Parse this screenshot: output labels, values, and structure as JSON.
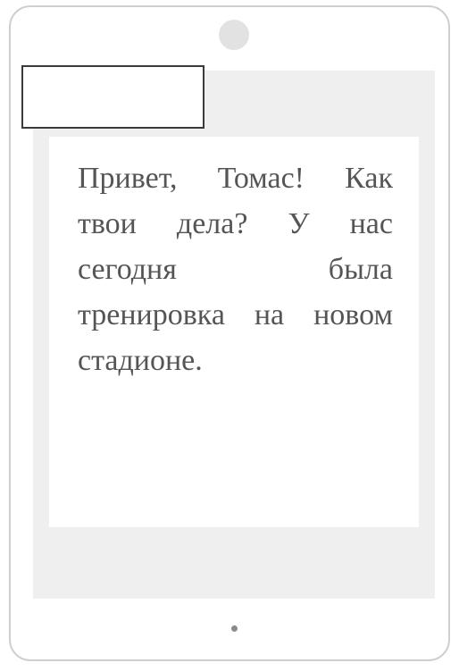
{
  "message": {
    "text": "Привет, Томас! Как твои дела? У нас сегодня была тренировка на новом стадионе."
  },
  "sticker_box": {
    "text": ""
  }
}
